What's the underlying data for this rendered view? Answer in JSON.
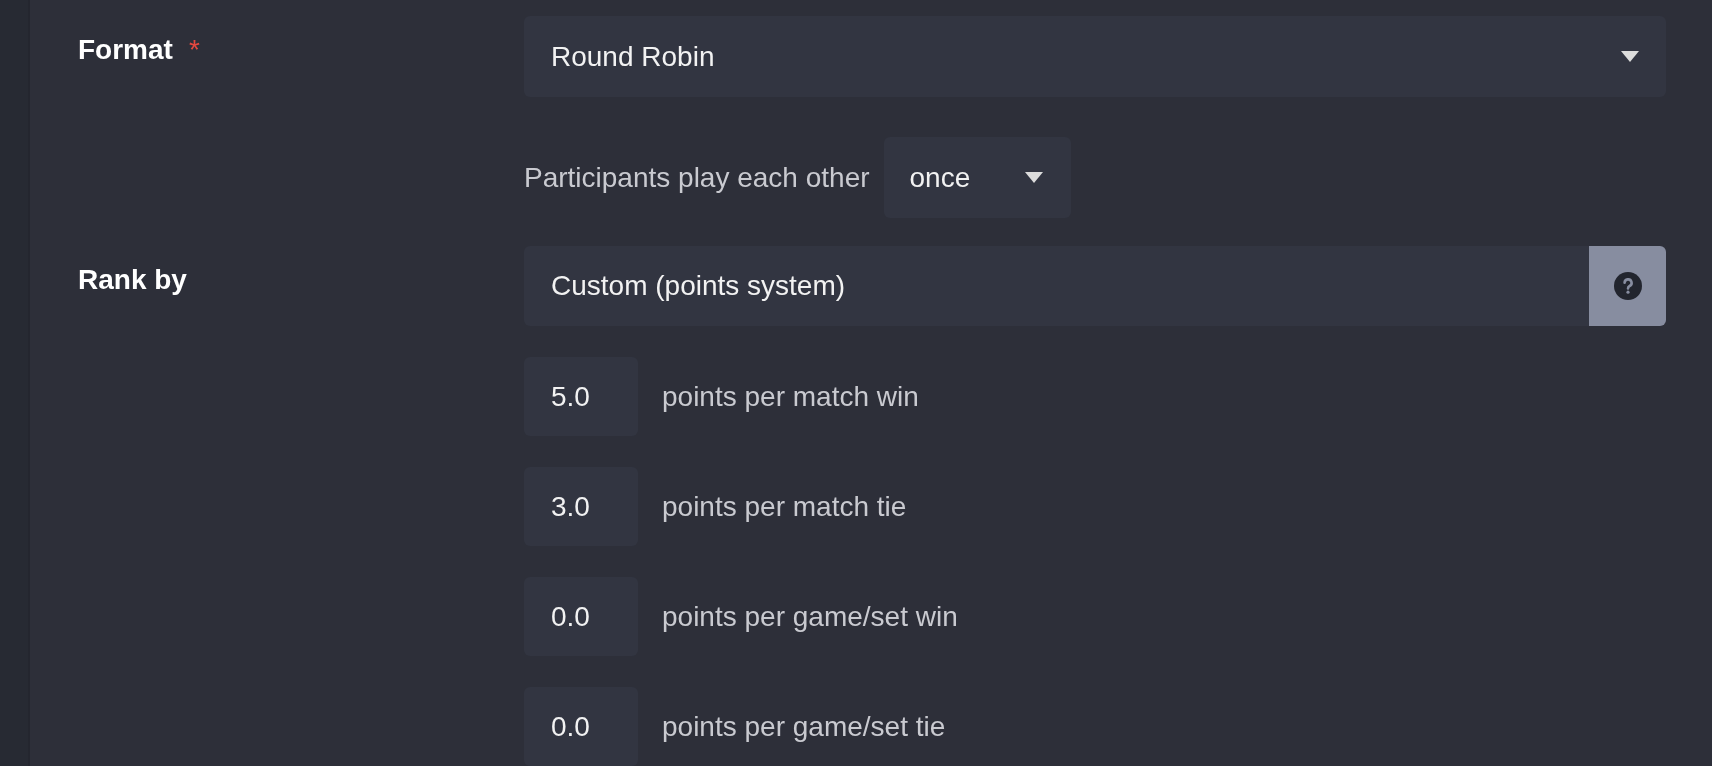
{
  "fields": [
    {
      "kind": "select",
      "label": "Format",
      "required_mark": "*",
      "control": {
        "value": "Round Robin"
      },
      "options": [
        {
          "kind": "inline_select",
          "label": "Participants play each other",
          "value": "once"
        }
      ]
    },
    {
      "kind": "select_with_help",
      "label": "Rank by",
      "control": {
        "value": "Custom (points system)"
      },
      "options": [
        {
          "kind": "number",
          "value": "5.0",
          "label": "points per match win"
        },
        {
          "kind": "number",
          "value": "3.0",
          "label": "points per match tie"
        },
        {
          "kind": "number",
          "value": "0.0",
          "label": "points per game/set win"
        },
        {
          "kind": "number",
          "value": "0.0",
          "label": "points per game/set tie"
        }
      ]
    }
  ]
}
